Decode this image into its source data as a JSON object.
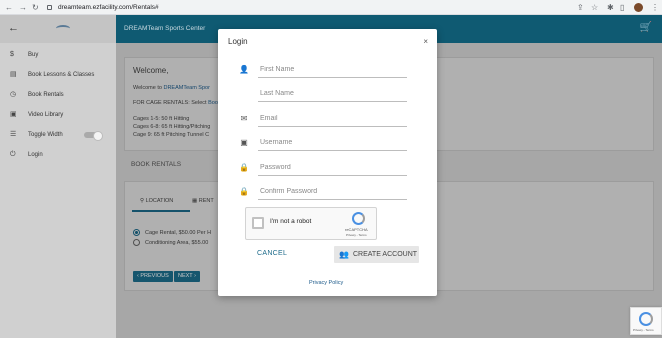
{
  "browser": {
    "url": "dreamteam.ezfacility.com/Rentals#"
  },
  "app": {
    "title": "DREAMTeam Sports Center"
  },
  "sidebar": {
    "items": [
      {
        "label": "Buy",
        "icon": "dollar-icon"
      },
      {
        "label": "Book Lessons & Classes",
        "icon": "book-icon"
      },
      {
        "label": "Book Rentals",
        "icon": "clock-icon"
      },
      {
        "label": "Video Library",
        "icon": "video-icon"
      },
      {
        "label": "Toggle Width",
        "icon": "list-icon"
      },
      {
        "label": "Login",
        "icon": "power-icon"
      }
    ]
  },
  "main": {
    "welcome_title": "Welcome,",
    "welcome_line": "Welcome to ",
    "welcome_link": "DREAMTeam Spor",
    "cage_line": "FOR CAGE RENTALS: Select ",
    "cage_link": "Book",
    "cages": [
      "Cages 1-5: 50 ft Hitting",
      "Cages 6-8: 65 ft Hitting/Pitching",
      "Cage 9: 65 ft Pitching Tunnel C"
    ],
    "section_title": "BOOK RENTALS",
    "tab_location": "LOCATION",
    "tab_rental": "RENT",
    "options": [
      {
        "label": "Cage Rental, $50.00 Per H",
        "selected": true
      },
      {
        "label": "Conditioning Area, $55.00",
        "selected": false
      }
    ],
    "prev_label": "‹ PREVIOUS",
    "next_label": "NEXT ›"
  },
  "modal": {
    "title": "Login",
    "close": "×",
    "fields": {
      "first_name": "First Name",
      "last_name": "Last Name",
      "email": "Email",
      "username": "Username",
      "password": "Password",
      "confirm_password": "Confirm Password"
    },
    "captcha": {
      "label": "I'm not a robot",
      "brand": "reCAPTCHA",
      "links": "Privacy - Terms"
    },
    "cancel": "CANCEL",
    "create_account": "CREATE ACCOUNT",
    "privacy_policy": "Privacy Policy"
  },
  "badge": {
    "links": "Privacy - Terms"
  },
  "colors": {
    "appbar": "#0f5a72",
    "accent": "#1c6a8a"
  }
}
